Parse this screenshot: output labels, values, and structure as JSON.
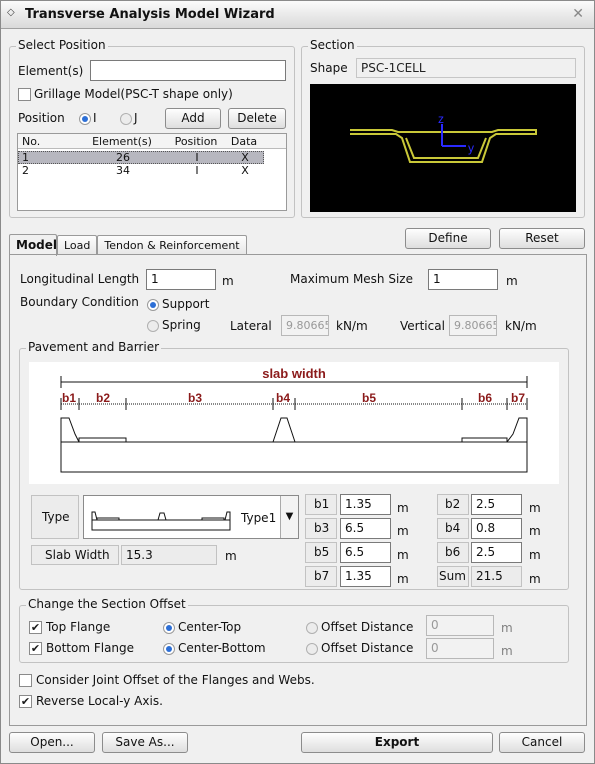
{
  "window": {
    "title": "Transverse Analysis Model Wizard"
  },
  "select_position": {
    "caption": "Select Position",
    "elements_label": "Element(s)",
    "elements_value": "",
    "grillage_label": "Grillage Model(PSC-T shape only)",
    "position_label": "Position",
    "radio_i": "I",
    "radio_j": "J",
    "add": "Add",
    "delete": "Delete",
    "columns": [
      "No.",
      "Element(s)",
      "Position",
      "Data"
    ],
    "rows": [
      {
        "no": "1",
        "element": "26",
        "position": "I",
        "data": "X"
      },
      {
        "no": "2",
        "element": "34",
        "position": "I",
        "data": "X"
      }
    ]
  },
  "section": {
    "caption": "Section",
    "shape_label": "Shape",
    "shape_value": "PSC-1CELL",
    "axis_z": "z",
    "axis_y": "y",
    "colors": {
      "bg": "#000000",
      "shape": "#c9c838",
      "axis": "#2a2aff"
    }
  },
  "top_buttons": {
    "define": "Define",
    "reset": "Reset"
  },
  "tabs": [
    "Model",
    "Load",
    "Tendon & Reinforcement"
  ],
  "model": {
    "long_length_label": "Longitudinal Length",
    "long_length_value": "1",
    "long_length_unit": "m",
    "mesh_label": "Maximum Mesh Size",
    "mesh_value": "1",
    "mesh_unit": "m",
    "boundary_label": "Boundary Condition",
    "support": "Support",
    "spring": "Spring",
    "lateral_label": "Lateral",
    "lateral_value": "9.80665",
    "vertical_label": "Vertical",
    "vertical_value": "9.80665",
    "spring_unit": "kN/m"
  },
  "pavement": {
    "caption": "Pavement and Barrier",
    "slab_width_title": "slab width",
    "dims": [
      "b1",
      "b2",
      "b3",
      "b4",
      "b5",
      "b6",
      "b7"
    ],
    "type_label": "Type",
    "type_value": "Type1",
    "slab_width_label": "Slab Width",
    "slab_width_value": "15.3",
    "slab_width_unit": "m",
    "fields": [
      {
        "label": "b1",
        "value": "1.35",
        "unit": "m"
      },
      {
        "label": "b2",
        "value": "2.5",
        "unit": "m"
      },
      {
        "label": "b3",
        "value": "6.5",
        "unit": "m"
      },
      {
        "label": "b4",
        "value": "0.8",
        "unit": "m"
      },
      {
        "label": "b5",
        "value": "6.5",
        "unit": "m"
      },
      {
        "label": "b6",
        "value": "2.5",
        "unit": "m"
      },
      {
        "label": "b7",
        "value": "1.35",
        "unit": "m"
      },
      {
        "label": "Sum",
        "value": "21.5",
        "unit": "m"
      }
    ],
    "colors": {
      "dim_text": "#8b1a1a"
    }
  },
  "offset": {
    "caption": "Change the Section Offset",
    "top_flange": "Top Flange",
    "bottom_flange": "Bottom Flange",
    "center_top": "Center-Top",
    "center_bottom": "Center-Bottom",
    "offset_distance": "Offset Distance",
    "top_value": "0",
    "bottom_value": "0",
    "unit": "m"
  },
  "options": {
    "joint_offset": "Consider Joint Offset of the Flanges and Webs.",
    "reverse_axis": "Reverse Local-y Axis."
  },
  "footer": {
    "open": "Open...",
    "save_as": "Save As...",
    "export": "Export",
    "cancel": "Cancel"
  }
}
